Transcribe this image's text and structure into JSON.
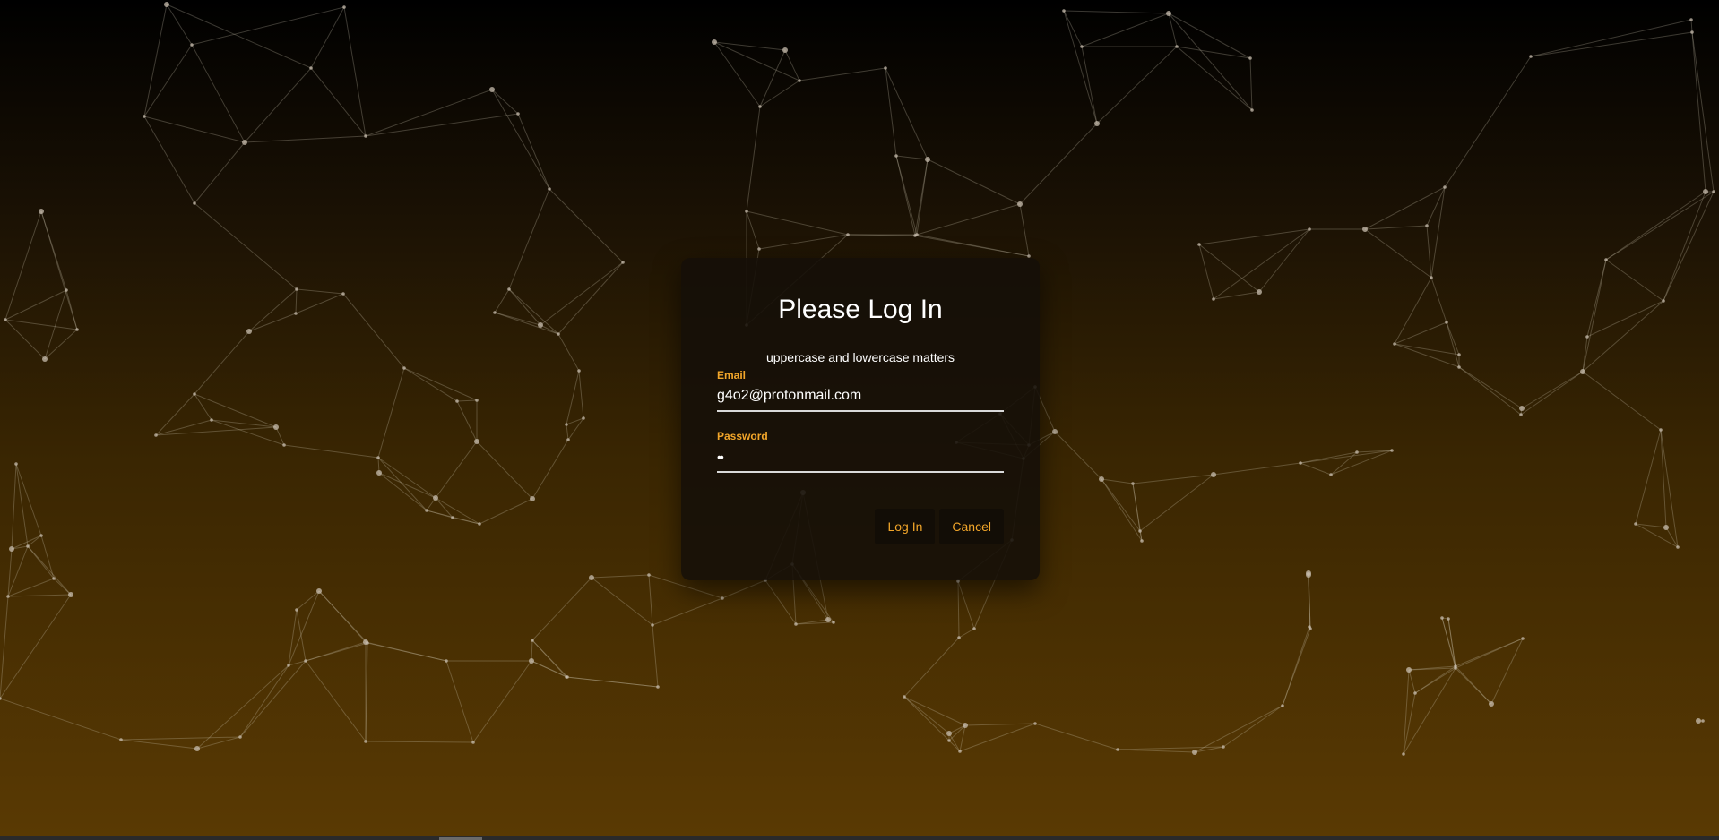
{
  "dialog": {
    "title": "Please Log In",
    "hint": "uppercase and lowercase matters",
    "email": {
      "label": "Email",
      "value": "g4o2@protonmail.com"
    },
    "password": {
      "label": "Password",
      "value": "••"
    },
    "buttons": {
      "login": "Log In",
      "cancel": "Cancel"
    }
  },
  "colors": {
    "accent": "#f2a62a",
    "background_top": "#000000",
    "background_bottom": "#5a3a03",
    "dialog_bg": "#140f08"
  }
}
